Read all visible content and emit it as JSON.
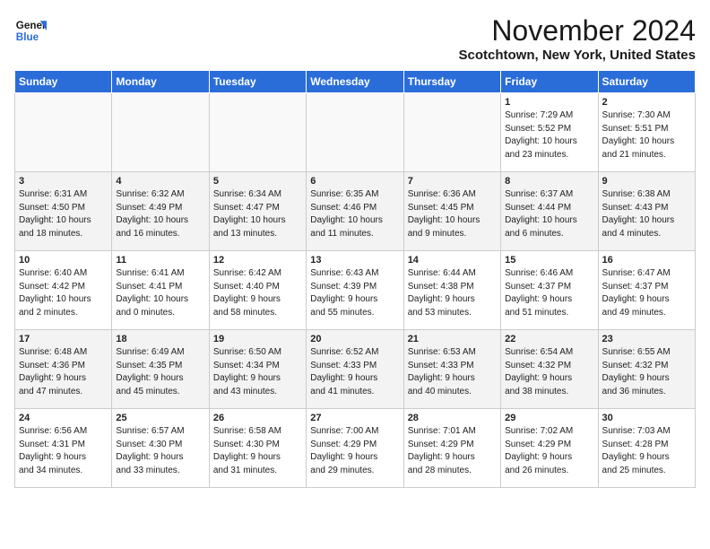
{
  "header": {
    "logo_line1": "General",
    "logo_line2": "Blue",
    "month_year": "November 2024",
    "location": "Scotchtown, New York, United States"
  },
  "weekdays": [
    "Sunday",
    "Monday",
    "Tuesday",
    "Wednesday",
    "Thursday",
    "Friday",
    "Saturday"
  ],
  "weeks": [
    [
      {
        "day": "",
        "content": ""
      },
      {
        "day": "",
        "content": ""
      },
      {
        "day": "",
        "content": ""
      },
      {
        "day": "",
        "content": ""
      },
      {
        "day": "",
        "content": ""
      },
      {
        "day": "1",
        "content": "Sunrise: 7:29 AM\nSunset: 5:52 PM\nDaylight: 10 hours\nand 23 minutes."
      },
      {
        "day": "2",
        "content": "Sunrise: 7:30 AM\nSunset: 5:51 PM\nDaylight: 10 hours\nand 21 minutes."
      }
    ],
    [
      {
        "day": "3",
        "content": "Sunrise: 6:31 AM\nSunset: 4:50 PM\nDaylight: 10 hours\nand 18 minutes."
      },
      {
        "day": "4",
        "content": "Sunrise: 6:32 AM\nSunset: 4:49 PM\nDaylight: 10 hours\nand 16 minutes."
      },
      {
        "day": "5",
        "content": "Sunrise: 6:34 AM\nSunset: 4:47 PM\nDaylight: 10 hours\nand 13 minutes."
      },
      {
        "day": "6",
        "content": "Sunrise: 6:35 AM\nSunset: 4:46 PM\nDaylight: 10 hours\nand 11 minutes."
      },
      {
        "day": "7",
        "content": "Sunrise: 6:36 AM\nSunset: 4:45 PM\nDaylight: 10 hours\nand 9 minutes."
      },
      {
        "day": "8",
        "content": "Sunrise: 6:37 AM\nSunset: 4:44 PM\nDaylight: 10 hours\nand 6 minutes."
      },
      {
        "day": "9",
        "content": "Sunrise: 6:38 AM\nSunset: 4:43 PM\nDaylight: 10 hours\nand 4 minutes."
      }
    ],
    [
      {
        "day": "10",
        "content": "Sunrise: 6:40 AM\nSunset: 4:42 PM\nDaylight: 10 hours\nand 2 minutes."
      },
      {
        "day": "11",
        "content": "Sunrise: 6:41 AM\nSunset: 4:41 PM\nDaylight: 10 hours\nand 0 minutes."
      },
      {
        "day": "12",
        "content": "Sunrise: 6:42 AM\nSunset: 4:40 PM\nDaylight: 9 hours\nand 58 minutes."
      },
      {
        "day": "13",
        "content": "Sunrise: 6:43 AM\nSunset: 4:39 PM\nDaylight: 9 hours\nand 55 minutes."
      },
      {
        "day": "14",
        "content": "Sunrise: 6:44 AM\nSunset: 4:38 PM\nDaylight: 9 hours\nand 53 minutes."
      },
      {
        "day": "15",
        "content": "Sunrise: 6:46 AM\nSunset: 4:37 PM\nDaylight: 9 hours\nand 51 minutes."
      },
      {
        "day": "16",
        "content": "Sunrise: 6:47 AM\nSunset: 4:37 PM\nDaylight: 9 hours\nand 49 minutes."
      }
    ],
    [
      {
        "day": "17",
        "content": "Sunrise: 6:48 AM\nSunset: 4:36 PM\nDaylight: 9 hours\nand 47 minutes."
      },
      {
        "day": "18",
        "content": "Sunrise: 6:49 AM\nSunset: 4:35 PM\nDaylight: 9 hours\nand 45 minutes."
      },
      {
        "day": "19",
        "content": "Sunrise: 6:50 AM\nSunset: 4:34 PM\nDaylight: 9 hours\nand 43 minutes."
      },
      {
        "day": "20",
        "content": "Sunrise: 6:52 AM\nSunset: 4:33 PM\nDaylight: 9 hours\nand 41 minutes."
      },
      {
        "day": "21",
        "content": "Sunrise: 6:53 AM\nSunset: 4:33 PM\nDaylight: 9 hours\nand 40 minutes."
      },
      {
        "day": "22",
        "content": "Sunrise: 6:54 AM\nSunset: 4:32 PM\nDaylight: 9 hours\nand 38 minutes."
      },
      {
        "day": "23",
        "content": "Sunrise: 6:55 AM\nSunset: 4:32 PM\nDaylight: 9 hours\nand 36 minutes."
      }
    ],
    [
      {
        "day": "24",
        "content": "Sunrise: 6:56 AM\nSunset: 4:31 PM\nDaylight: 9 hours\nand 34 minutes."
      },
      {
        "day": "25",
        "content": "Sunrise: 6:57 AM\nSunset: 4:30 PM\nDaylight: 9 hours\nand 33 minutes."
      },
      {
        "day": "26",
        "content": "Sunrise: 6:58 AM\nSunset: 4:30 PM\nDaylight: 9 hours\nand 31 minutes."
      },
      {
        "day": "27",
        "content": "Sunrise: 7:00 AM\nSunset: 4:29 PM\nDaylight: 9 hours\nand 29 minutes."
      },
      {
        "day": "28",
        "content": "Sunrise: 7:01 AM\nSunset: 4:29 PM\nDaylight: 9 hours\nand 28 minutes."
      },
      {
        "day": "29",
        "content": "Sunrise: 7:02 AM\nSunset: 4:29 PM\nDaylight: 9 hours\nand 26 minutes."
      },
      {
        "day": "30",
        "content": "Sunrise: 7:03 AM\nSunset: 4:28 PM\nDaylight: 9 hours\nand 25 minutes."
      }
    ]
  ]
}
